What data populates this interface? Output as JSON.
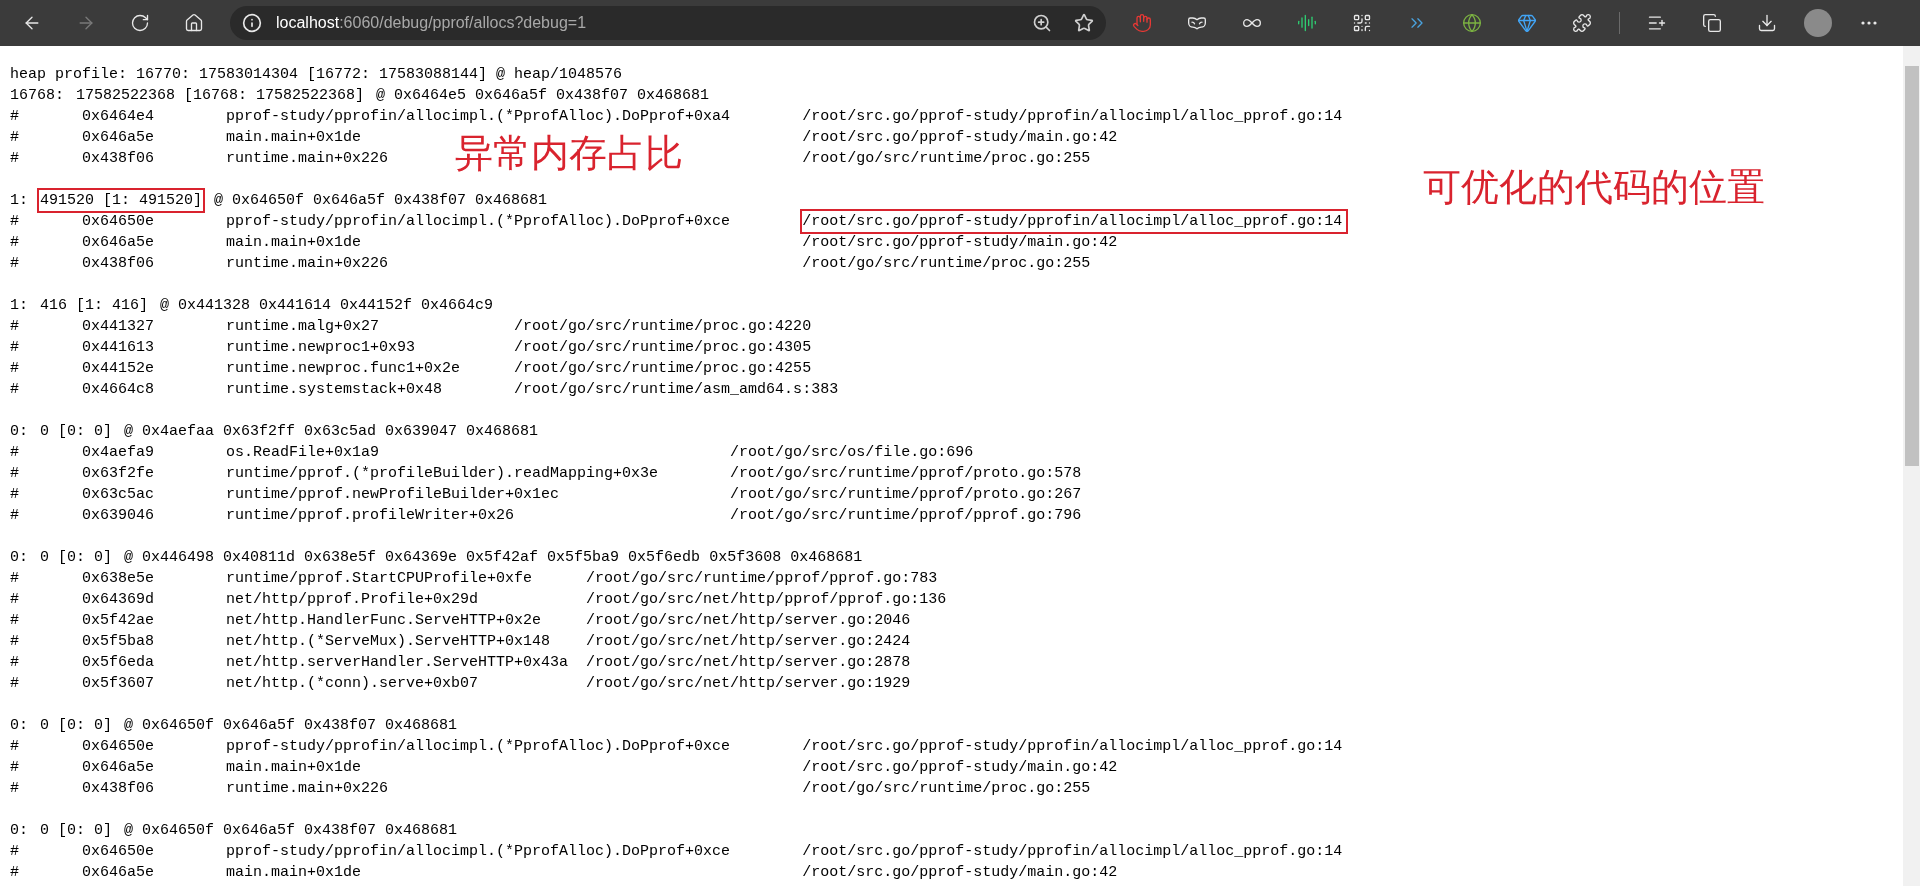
{
  "browser": {
    "url_host": "localhost",
    "url_path": ":6060/debug/pprof/allocs?debug=1"
  },
  "profile": {
    "summary": "heap profile: 16770: 17583014304 [16772: 17583088144] @ heap/1048576",
    "records": [
      {
        "count": "16768:",
        "stat": "17582522368 [16768: 17582522368]",
        "stack": "@ 0x6464e5 0x646a5f 0x438f07 0x468681",
        "highlighted": false,
        "frames": [
          {
            "marker": "#",
            "address": "0x6464e4",
            "function": "pprof-study/pprofin/allocimpl.(*PprofAlloc).DoPprof+0xa4",
            "location": "/root/src.go/pprof-study/pprofin/allocimpl/alloc_pprof.go:14",
            "highlighted": false
          },
          {
            "marker": "#",
            "address": "0x646a5e",
            "function": "main.main+0x1de",
            "location": "/root/src.go/pprof-study/main.go:42",
            "highlighted": false
          },
          {
            "marker": "#",
            "address": "0x438f06",
            "function": "runtime.main+0x226",
            "location": "/root/go/src/runtime/proc.go:255",
            "highlighted": false
          }
        ]
      },
      {
        "count": "1:",
        "stat": "491520 [1: 491520]",
        "stack": "@ 0x64650f 0x646a5f 0x438f07 0x468681",
        "highlighted": true,
        "frames": [
          {
            "marker": "#",
            "address": "0x64650e",
            "function": "pprof-study/pprofin/allocimpl.(*PprofAlloc).DoPprof+0xce",
            "location": "/root/src.go/pprof-study/pprofin/allocimpl/alloc_pprof.go:14",
            "highlighted": true
          },
          {
            "marker": "#",
            "address": "0x646a5e",
            "function": "main.main+0x1de",
            "location": "/root/src.go/pprof-study/main.go:42",
            "highlighted": false
          },
          {
            "marker": "#",
            "address": "0x438f06",
            "function": "runtime.main+0x226",
            "location": "/root/go/src/runtime/proc.go:255",
            "highlighted": false
          }
        ]
      },
      {
        "count": "1:",
        "stat": "416 [1: 416]",
        "stack": "@ 0x441328 0x441614 0x44152f 0x4664c9",
        "highlighted": false,
        "frames": [
          {
            "marker": "#",
            "address": "0x441327",
            "function": "runtime.malg+0x27",
            "location": "/root/go/src/runtime/proc.go:4220",
            "highlighted": false
          },
          {
            "marker": "#",
            "address": "0x441613",
            "function": "runtime.newproc1+0x93",
            "location": "/root/go/src/runtime/proc.go:4305",
            "highlighted": false
          },
          {
            "marker": "#",
            "address": "0x44152e",
            "function": "runtime.newproc.func1+0x2e",
            "location": "/root/go/src/runtime/proc.go:4255",
            "highlighted": false
          },
          {
            "marker": "#",
            "address": "0x4664c8",
            "function": "runtime.systemstack+0x48",
            "location": "/root/go/src/runtime/asm_amd64.s:383",
            "highlighted": false
          }
        ]
      },
      {
        "count": "0:",
        "stat": "0 [0: 0]",
        "stack": "@ 0x4aefaa 0x63f2ff 0x63c5ad 0x639047 0x468681",
        "highlighted": false,
        "frames": [
          {
            "marker": "#",
            "address": "0x4aefa9",
            "function": "os.ReadFile+0x1a9",
            "location": "/root/go/src/os/file.go:696",
            "highlighted": false
          },
          {
            "marker": "#",
            "address": "0x63f2fe",
            "function": "runtime/pprof.(*profileBuilder).readMapping+0x3e",
            "location": "/root/go/src/runtime/pprof/proto.go:578",
            "highlighted": false
          },
          {
            "marker": "#",
            "address": "0x63c5ac",
            "function": "runtime/pprof.newProfileBuilder+0x1ec",
            "location": "/root/go/src/runtime/pprof/proto.go:267",
            "highlighted": false
          },
          {
            "marker": "#",
            "address": "0x639046",
            "function": "runtime/pprof.profileWriter+0x26",
            "location": "/root/go/src/runtime/pprof/pprof.go:796",
            "highlighted": false
          }
        ]
      },
      {
        "count": "0:",
        "stat": "0 [0: 0]",
        "stack": "@ 0x446498 0x40811d 0x638e5f 0x64369e 0x5f42af 0x5f5ba9 0x5f6edb 0x5f3608 0x468681",
        "highlighted": false,
        "frames": [
          {
            "marker": "#",
            "address": "0x638e5e",
            "function": "runtime/pprof.StartCPUProfile+0xfe",
            "location": "/root/go/src/runtime/pprof/pprof.go:783",
            "highlighted": false
          },
          {
            "marker": "#",
            "address": "0x64369d",
            "function": "net/http/pprof.Profile+0x29d",
            "location": "/root/go/src/net/http/pprof/pprof.go:136",
            "highlighted": false
          },
          {
            "marker": "#",
            "address": "0x5f42ae",
            "function": "net/http.HandlerFunc.ServeHTTP+0x2e",
            "location": "/root/go/src/net/http/server.go:2046",
            "highlighted": false
          },
          {
            "marker": "#",
            "address": "0x5f5ba8",
            "function": "net/http.(*ServeMux).ServeHTTP+0x148",
            "location": "/root/go/src/net/http/server.go:2424",
            "highlighted": false
          },
          {
            "marker": "#",
            "address": "0x5f6eda",
            "function": "net/http.serverHandler.ServeHTTP+0x43a",
            "location": "/root/go/src/net/http/server.go:2878",
            "highlighted": false
          },
          {
            "marker": "#",
            "address": "0x5f3607",
            "function": "net/http.(*conn).serve+0xb07",
            "location": "/root/go/src/net/http/server.go:1929",
            "highlighted": false
          }
        ]
      },
      {
        "count": "0:",
        "stat": "0 [0: 0]",
        "stack": "@ 0x64650f 0x646a5f 0x438f07 0x468681",
        "highlighted": false,
        "frames": [
          {
            "marker": "#",
            "address": "0x64650e",
            "function": "pprof-study/pprofin/allocimpl.(*PprofAlloc).DoPprof+0xce",
            "location": "/root/src.go/pprof-study/pprofin/allocimpl/alloc_pprof.go:14",
            "highlighted": false
          },
          {
            "marker": "#",
            "address": "0x646a5e",
            "function": "main.main+0x1de",
            "location": "/root/src.go/pprof-study/main.go:42",
            "highlighted": false
          },
          {
            "marker": "#",
            "address": "0x438f06",
            "function": "runtime.main+0x226",
            "location": "/root/go/src/runtime/proc.go:255",
            "highlighted": false
          }
        ]
      },
      {
        "count": "0:",
        "stat": "0 [0: 0]",
        "stack": "@ 0x64650f 0x646a5f 0x438f07 0x468681",
        "highlighted": false,
        "frames": [
          {
            "marker": "#",
            "address": "0x64650e",
            "function": "pprof-study/pprofin/allocimpl.(*PprofAlloc).DoPprof+0xce",
            "location": "/root/src.go/pprof-study/pprofin/allocimpl/alloc_pprof.go:14",
            "highlighted": false
          },
          {
            "marker": "#",
            "address": "0x646a5e",
            "function": "main.main+0x1de",
            "location": "/root/src.go/pprof-study/main.go:42",
            "highlighted": false
          }
        ]
      }
    ]
  },
  "annotations": [
    {
      "text": "异常内存占比"
    },
    {
      "text": "可优化的代码的位置"
    }
  ]
}
